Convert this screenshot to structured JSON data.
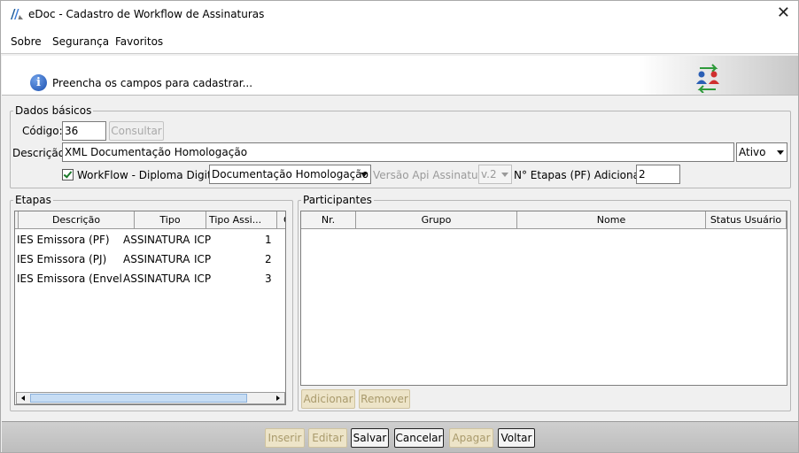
{
  "window": {
    "title": "eDoc - Cadastro de Workflow de Assinaturas",
    "icon": "edoc-logo-icon",
    "close_icon": "close-icon"
  },
  "menu": {
    "items": [
      "Sobre",
      "Segurança",
      "Favoritos"
    ]
  },
  "banner": {
    "message": "Preencha os campos para cadastrar...",
    "info_icon": "info-icon",
    "users_icon": "users-swap-icon"
  },
  "dados_basicos": {
    "legend": "Dados básicos",
    "codigo_label": "Código:",
    "codigo_value": "36",
    "consultar_label": "Consultar",
    "descricao_label": "Descrição:",
    "descricao_value": "XML Documentação Homologação",
    "status_value": "Ativo",
    "workflow_label": "WorkFlow - Diploma Digital",
    "workflow_checked": true,
    "workflow_value": "Documentação Homologação",
    "versao_label": "Versão Api Assinatura:",
    "versao_value": "v.2",
    "etapas_pf_label": "N° Etapas (PF) Adicionais:",
    "etapas_pf_value": "2"
  },
  "etapas": {
    "legend": "Etapas",
    "columns": [
      "Descrição",
      "Tipo",
      "Tipo Assi...",
      "Ord"
    ],
    "rows": [
      [
        "IES Emissora (PF)",
        "ASSINATURA",
        "ICP",
        "1"
      ],
      [
        "IES Emissora (PJ)",
        "ASSINATURA",
        "ICP",
        "2"
      ],
      [
        "IES Emissora (Envelo...",
        "ASSINATURA",
        "ICP",
        "3"
      ]
    ]
  },
  "participantes": {
    "legend": "Participantes",
    "columns": [
      "Nr.",
      "Grupo",
      "Nome",
      "Status Usuário"
    ],
    "rows": [],
    "adicionar_label": "Adicionar",
    "remover_label": "Remover"
  },
  "footer": {
    "inserir_label": "Inserir",
    "editar_label": "Editar",
    "salvar_label": "Salvar",
    "cancelar_label": "Cancelar",
    "apagar_label": "Apagar",
    "voltar_label": "Voltar"
  },
  "colors": {
    "disabled_gold_bg": "#ede4c8",
    "thumb": "#c7ddf4",
    "check_green": "#1a7a2a"
  }
}
